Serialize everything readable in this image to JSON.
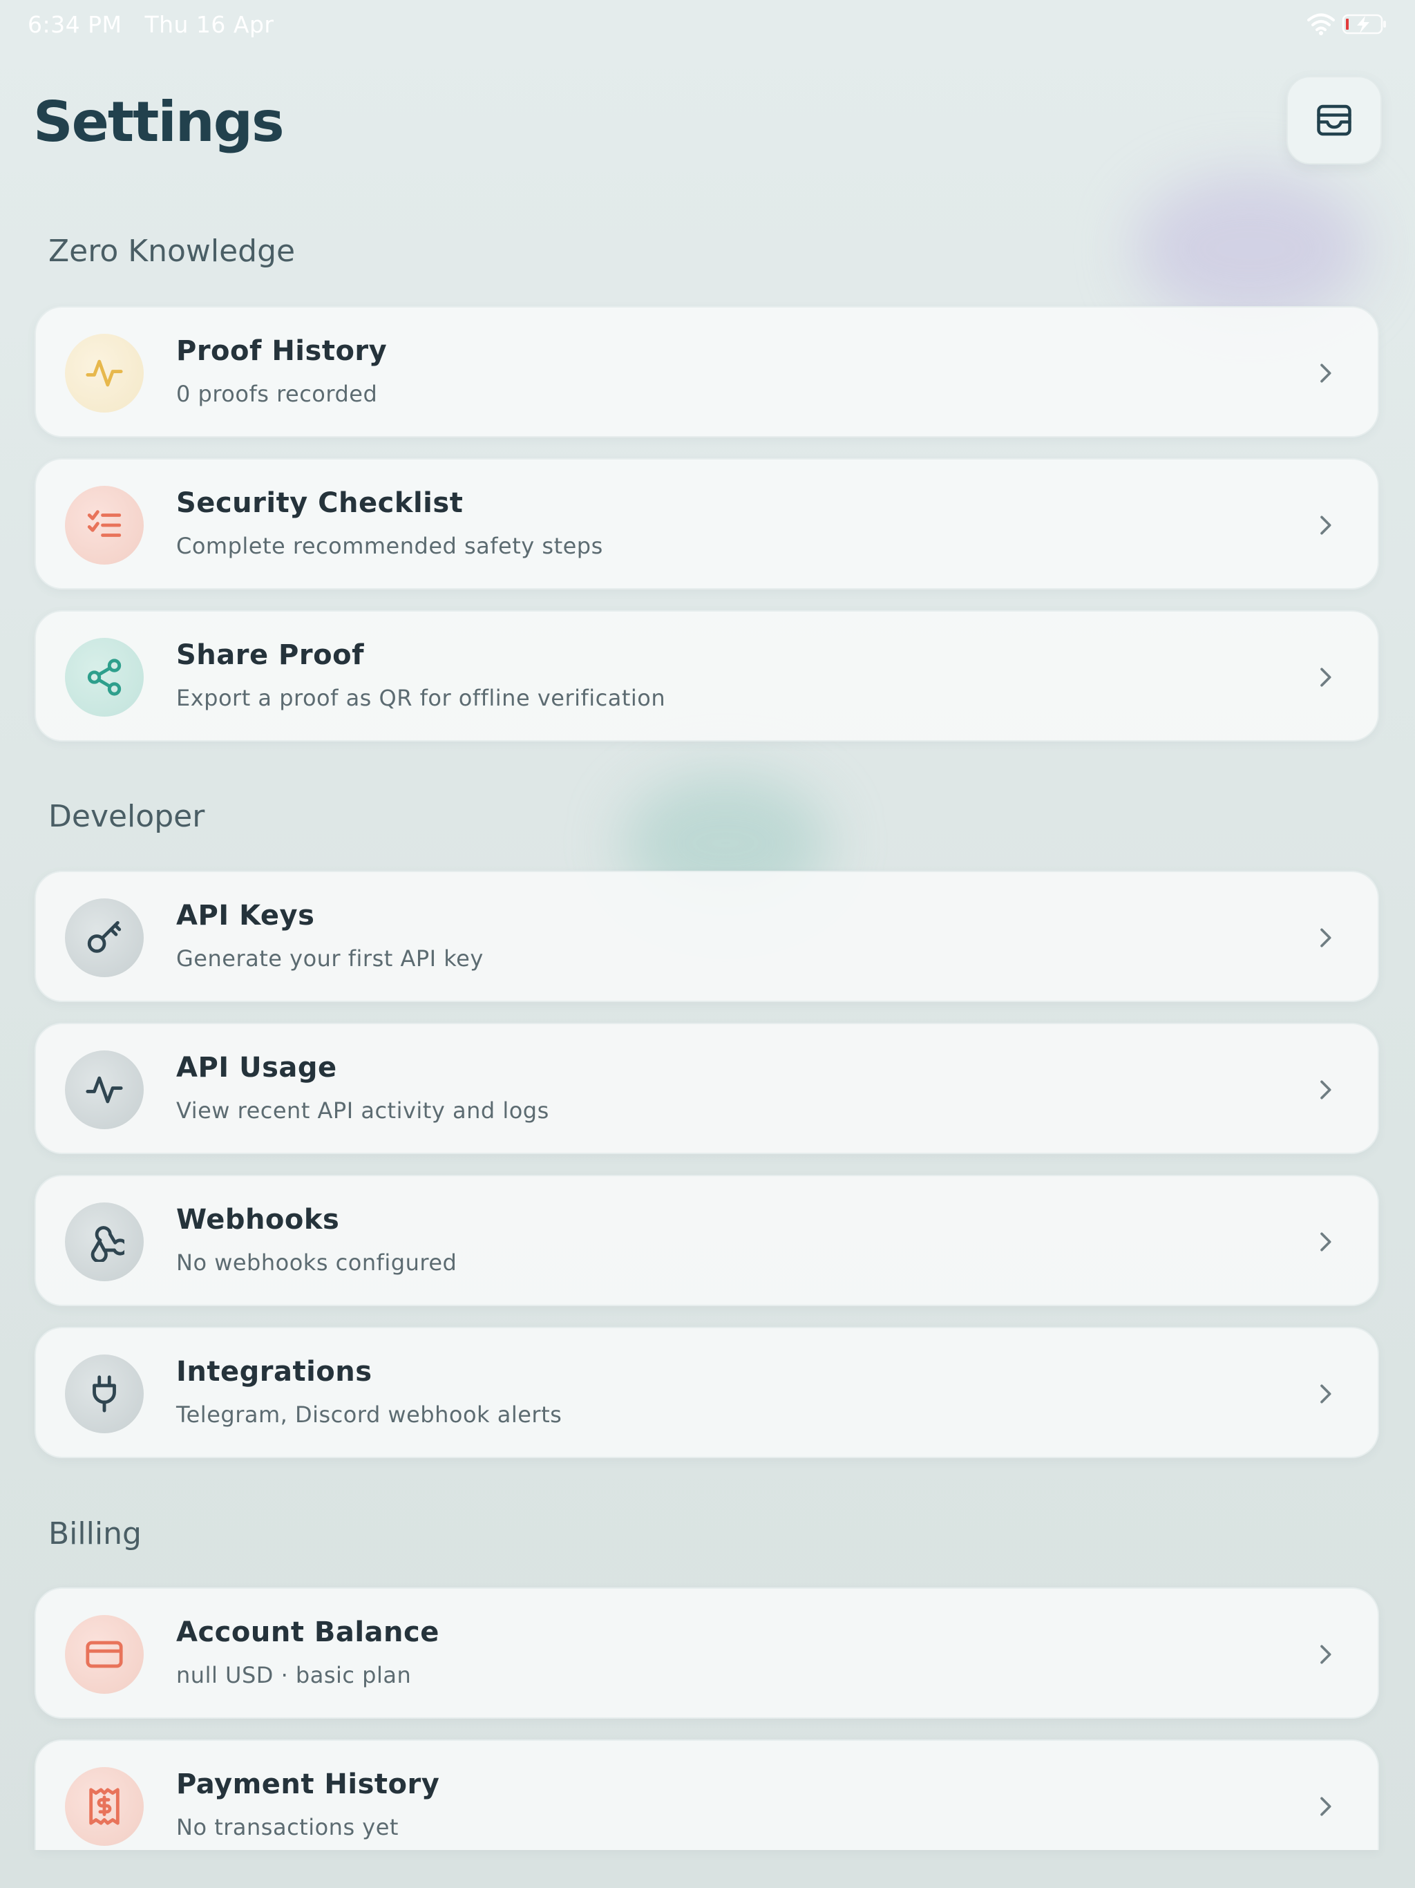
{
  "status_bar": {
    "time": "6:34 PM",
    "date": "Thu 16 Apr"
  },
  "header": {
    "title": "Settings",
    "action_icon": "archive-box-icon"
  },
  "sections": {
    "zero_knowledge": {
      "title": "Zero Knowledge",
      "items": [
        {
          "label": "Proof History",
          "subtitle": "0 proofs recorded",
          "icon": "activity-icon"
        },
        {
          "label": "Security Checklist",
          "subtitle": "Complete recommended safety steps",
          "icon": "checklist-icon"
        },
        {
          "label": "Share Proof",
          "subtitle": "Export a proof as QR for offline verification",
          "icon": "share-icon"
        }
      ]
    },
    "developer": {
      "title": "Developer",
      "items": [
        {
          "label": "API Keys",
          "subtitle": "Generate your first API key",
          "icon": "key-icon"
        },
        {
          "label": "API Usage",
          "subtitle": "View recent API activity and logs",
          "icon": "activity-icon"
        },
        {
          "label": "Webhooks",
          "subtitle": "No webhooks configured",
          "icon": "webhook-icon"
        },
        {
          "label": "Integrations",
          "subtitle": "Telegram, Discord webhook alerts",
          "icon": "plug-icon"
        }
      ]
    },
    "billing": {
      "title": "Billing",
      "items": [
        {
          "label": "Account Balance",
          "subtitle": "null USD · basic plan",
          "icon": "credit-card-icon"
        },
        {
          "label": "Payment History",
          "subtitle": "No transactions yet",
          "icon": "receipt-icon"
        }
      ]
    }
  },
  "colors": {
    "title": "#22414d",
    "amber_icon": "#e7b84c",
    "coral_icon": "#e8735a",
    "teal_icon": "#2e9f8c",
    "slate_icon": "#2f4550"
  }
}
